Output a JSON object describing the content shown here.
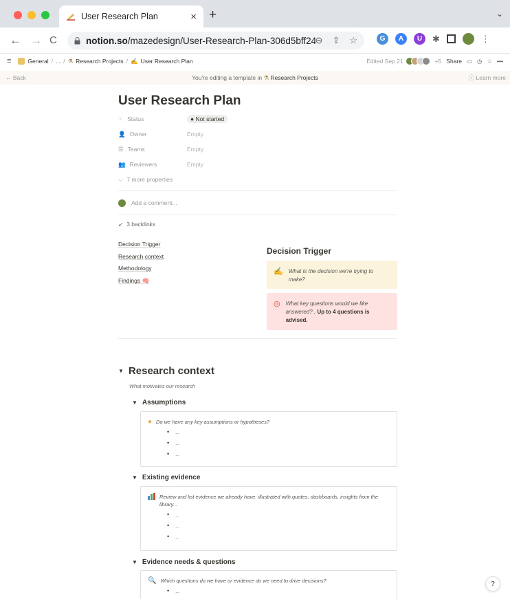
{
  "browser": {
    "tab_title": "User Research Plan",
    "tab_close": "×",
    "new_tab": "+",
    "tabs_menu": "⌄",
    "url_host": "notion.so",
    "url_path": "/mazedesign/User-Research-Plan-306d5bff24...",
    "window_dots": [
      "#ff5f57",
      "#febc2e",
      "#28c840"
    ]
  },
  "notion_topbar": {
    "breadcrumb_general": "General",
    "breadcrumb_ellipsis": "...",
    "breadcrumb_projects": "Research Projects",
    "breadcrumb_current": "User Research Plan",
    "edited": "Edited Sep 21",
    "extra_count": "+5",
    "share_label": "Share",
    "more": "•••"
  },
  "template_bar": {
    "back": "← Back",
    "message_prefix": "You're editing a template in",
    "message_target": "Research Projects",
    "learn_more": "Learn more"
  },
  "page": {
    "title": "User Research Plan",
    "properties": [
      {
        "name": "Status",
        "value": "● Not started"
      },
      {
        "name": "Owner",
        "value": "Empty"
      },
      {
        "name": "Teams",
        "value": "Empty"
      },
      {
        "name": "Reviewers",
        "value": "Empty"
      }
    ],
    "more_properties": "7 more properties",
    "comment_placeholder": "Add a comment...",
    "backlinks": "3 backlinks"
  },
  "toc": [
    "Decision Trigger",
    "Research context",
    "Methodology",
    "Findings 🧠"
  ],
  "decision_trigger": {
    "heading": "Decision Trigger",
    "callout1": "What is the decision we're trying to make?",
    "callout2_italic": "What key questions would we like answered? ,",
    "callout2_bold": "Up to 4 questions is advised."
  },
  "research_context": {
    "heading": "Research context",
    "subtitle": "What motivates our research",
    "assumptions": {
      "heading": "Assumptions",
      "prompt": "Do we have any key assumptions or hypotheses?",
      "bullets": [
        "...",
        "...",
        "..."
      ]
    },
    "existing_evidence": {
      "heading": "Existing evidence",
      "prompt": "Review and list evidence we already have: illustrated with quotes, dashboards, insights from the library...",
      "bullets": [
        "...",
        "...",
        "..."
      ]
    },
    "evidence_needs": {
      "heading": "Evidence needs & questions",
      "prompt": "Which questions do we have or evidence do we need to drive decisions?",
      "bullets": [
        "..."
      ]
    }
  },
  "help_label": "?"
}
